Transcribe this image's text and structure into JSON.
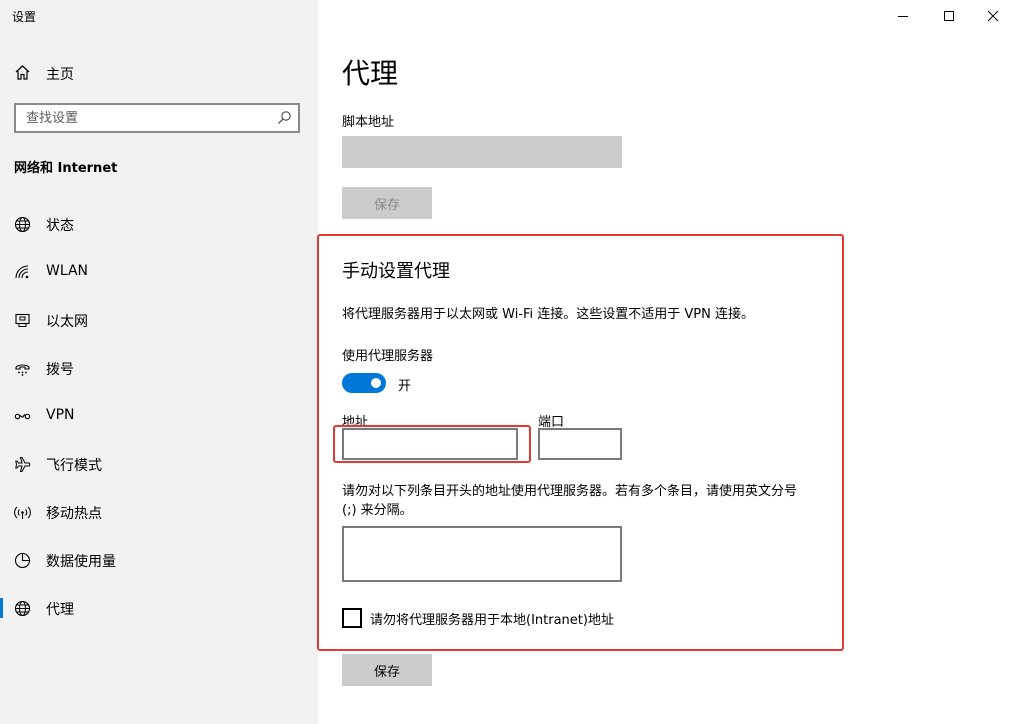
{
  "window": {
    "title": "设置"
  },
  "sidebar": {
    "home_label": "主页",
    "search_placeholder": "查找设置",
    "section_title": "网络和 Internet",
    "items": [
      {
        "label": "状态",
        "icon": "globe-status-icon"
      },
      {
        "label": "WLAN",
        "icon": "wifi-icon"
      },
      {
        "label": "以太网",
        "icon": "ethernet-icon"
      },
      {
        "label": "拨号",
        "icon": "dialup-icon"
      },
      {
        "label": "VPN",
        "icon": "vpn-icon"
      },
      {
        "label": "飞行模式",
        "icon": "airplane-icon"
      },
      {
        "label": "移动热点",
        "icon": "hotspot-icon"
      },
      {
        "label": "数据使用量",
        "icon": "data-usage-icon"
      },
      {
        "label": "代理",
        "icon": "globe-icon",
        "active": true
      }
    ]
  },
  "main": {
    "page_title": "代理",
    "script_address_label": "脚本地址",
    "script_save_label": "保存",
    "manual_title": "手动设置代理",
    "manual_description": "将代理服务器用于以太网或 Wi-Fi 连接。这些设置不适用于 VPN 连接。",
    "use_proxy_label": "使用代理服务器",
    "toggle_state": "开",
    "address_label": "地址",
    "port_label": "端口",
    "exceptions_description": "请勿对以下列条目开头的地址使用代理服务器。若有多个条目，请使用英文分号 (;) 来分隔。",
    "local_checkbox_label": "请勿将代理服务器用于本地(Intranet)地址",
    "save_label": "保存"
  },
  "colors": {
    "accent": "#0078d7",
    "highlight": "#e53935",
    "sidebar_bg": "#f2f2f2"
  }
}
